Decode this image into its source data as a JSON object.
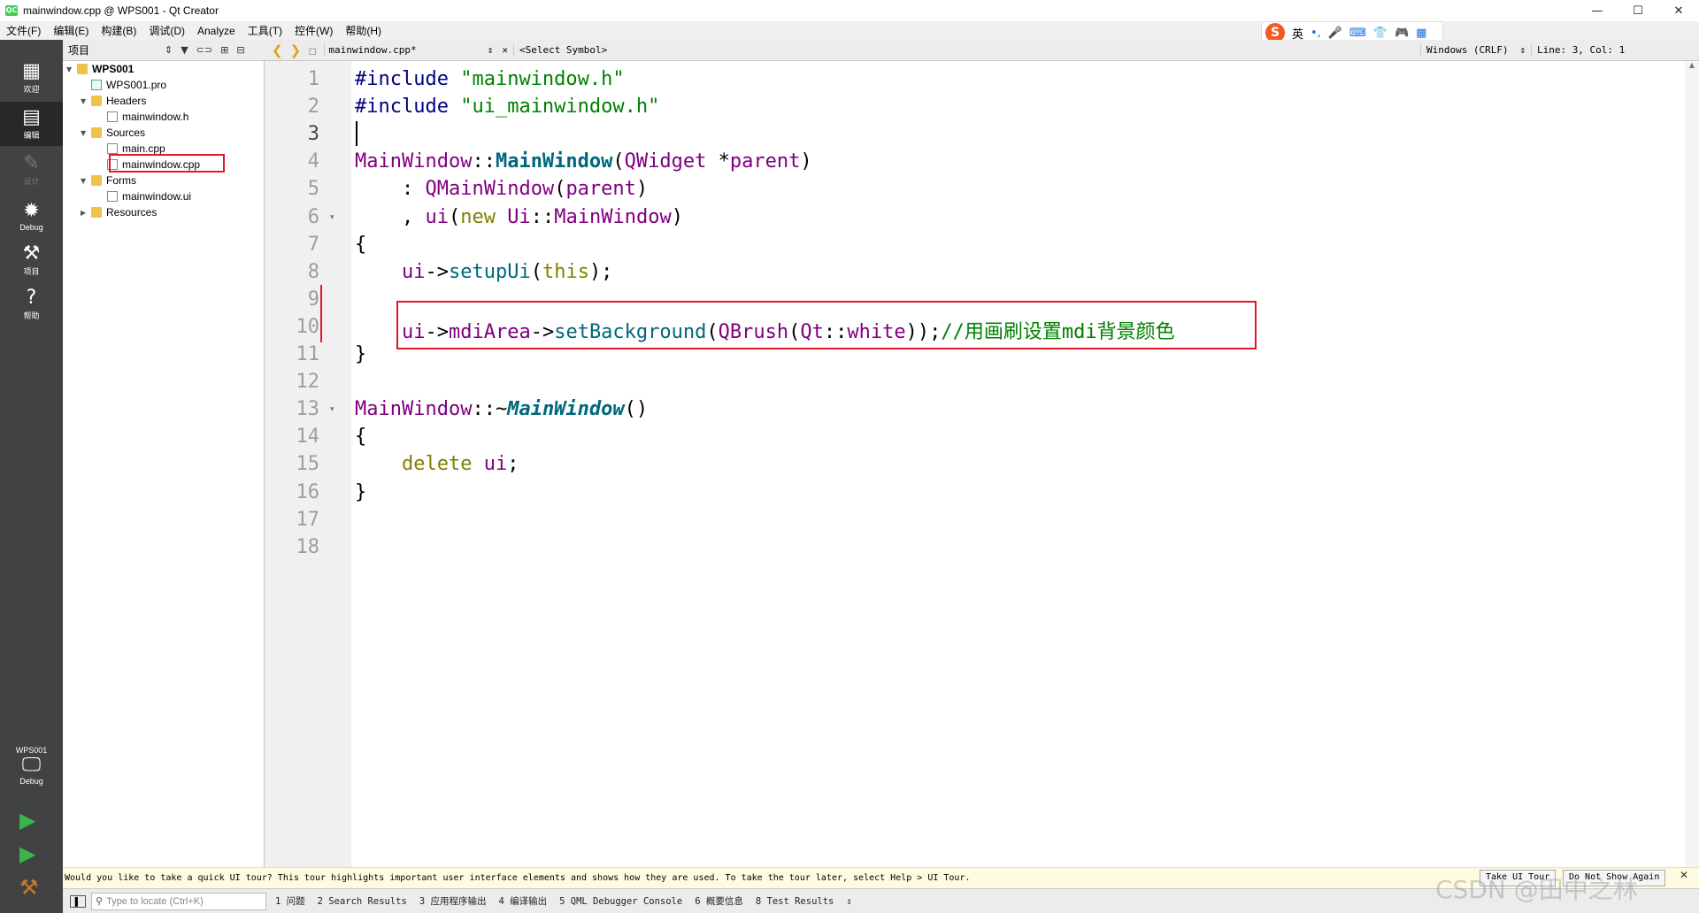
{
  "window": {
    "title": "mainwindow.cpp @ WPS001 - Qt Creator",
    "app_icon_text": "QC",
    "controls": [
      "—",
      "☐",
      "✕"
    ]
  },
  "menu": [
    "文件(F)",
    "编辑(E)",
    "构建(B)",
    "调试(D)",
    "Analyze",
    "工具(T)",
    "控件(W)",
    "帮助(H)"
  ],
  "ime": {
    "logo": "S",
    "lang": "英",
    "icons": [
      "•,",
      "🎤",
      "⌨",
      "👕",
      "🎮",
      "▦"
    ]
  },
  "modes": [
    {
      "label": "欢迎",
      "icon": "grid-icon"
    },
    {
      "label": "编辑",
      "icon": "edit-icon"
    },
    {
      "label": "设计",
      "icon": "pencil-icon"
    },
    {
      "label": "Debug",
      "icon": "bug-icon"
    },
    {
      "label": "项目",
      "icon": "wrench-icon"
    },
    {
      "label": "帮助",
      "icon": "help-icon"
    }
  ],
  "kit": {
    "project": "WPS001",
    "config": "Debug"
  },
  "project_pane": {
    "title": "项目",
    "tree": [
      {
        "label": "WPS001",
        "level": 0,
        "expanded": true,
        "kind": "project"
      },
      {
        "label": "WPS001.pro",
        "level": 1,
        "kind": "pro"
      },
      {
        "label": "Headers",
        "level": 1,
        "expanded": true,
        "kind": "folder"
      },
      {
        "label": "mainwindow.h",
        "level": 2,
        "kind": "file"
      },
      {
        "label": "Sources",
        "level": 1,
        "expanded": true,
        "kind": "folder"
      },
      {
        "label": "main.cpp",
        "level": 2,
        "kind": "file"
      },
      {
        "label": "mainwindow.cpp",
        "level": 2,
        "kind": "file",
        "selected": true
      },
      {
        "label": "Forms",
        "level": 1,
        "expanded": true,
        "kind": "folder"
      },
      {
        "label": "mainwindow.ui",
        "level": 2,
        "kind": "file"
      },
      {
        "label": "Resources",
        "level": 1,
        "expanded": false,
        "kind": "folder"
      }
    ]
  },
  "editor_toolbar": {
    "file": "mainwindow.cpp*",
    "symbol": "<Select Symbol>",
    "line_ending": "Windows (CRLF)",
    "position": "Line: 3, Col: 1"
  },
  "editor": {
    "current_line": 3,
    "line_numbers": [
      "1",
      "2",
      "3",
      "4",
      "5",
      "6",
      "7",
      "8",
      "9",
      "10",
      "11",
      "12",
      "13",
      "14",
      "15",
      "16",
      "17",
      "18"
    ],
    "fold_markers": [
      "▾",
      "▾"
    ],
    "lines": [
      [
        [
          "pp",
          "#include "
        ],
        [
          "str",
          "\"mainwindow.h\""
        ]
      ],
      [
        [
          "pp",
          "#include "
        ],
        [
          "str",
          "\"ui_mainwindow.h\""
        ]
      ],
      [],
      [
        [
          "ty",
          "MainWindow"
        ],
        [
          "op",
          "::"
        ],
        [
          "dec",
          "MainWindow"
        ],
        [
          "op",
          "("
        ],
        [
          "ty",
          "QWidget"
        ],
        [
          "op",
          " *"
        ],
        [
          "ty",
          "parent"
        ],
        [
          "op",
          ")"
        ]
      ],
      [
        [
          "op",
          "    : "
        ],
        [
          "ty",
          "QMainWindow"
        ],
        [
          "op",
          "("
        ],
        [
          "ty",
          "parent"
        ],
        [
          "op",
          ")"
        ]
      ],
      [
        [
          "op",
          "    , "
        ],
        [
          "ty",
          "ui"
        ],
        [
          "op",
          "("
        ],
        [
          "kw",
          "new"
        ],
        [
          "op",
          " "
        ],
        [
          "ty",
          "Ui"
        ],
        [
          "op",
          "::"
        ],
        [
          "ty",
          "MainWindow"
        ],
        [
          "op",
          ")"
        ]
      ],
      [
        [
          "op",
          "{"
        ]
      ],
      [
        [
          "op",
          "    "
        ],
        [
          "ty",
          "ui"
        ],
        [
          "op",
          "->"
        ],
        [
          "fn",
          "setupUi"
        ],
        [
          "op",
          "("
        ],
        [
          "kw",
          "this"
        ],
        [
          "op",
          ");"
        ]
      ],
      [],
      [
        [
          "op",
          "    "
        ],
        [
          "ty",
          "ui"
        ],
        [
          "op",
          "->"
        ],
        [
          "ty",
          "mdiArea"
        ],
        [
          "op",
          "->"
        ],
        [
          "fn",
          "setBackground"
        ],
        [
          "op",
          "("
        ],
        [
          "ty",
          "QBrush"
        ],
        [
          "op",
          "("
        ],
        [
          "ty",
          "Qt"
        ],
        [
          "op",
          "::"
        ],
        [
          "ty",
          "white"
        ],
        [
          "op",
          "));"
        ],
        [
          "cm",
          "//用画刷设置mdi背景颜色"
        ]
      ],
      [
        [
          "op",
          "}"
        ]
      ],
      [],
      [
        [
          "ty",
          "MainWindow"
        ],
        [
          "op",
          "::~"
        ],
        [
          "it",
          "MainWindow"
        ],
        [
          "op",
          "()"
        ]
      ],
      [
        [
          "op",
          "{"
        ]
      ],
      [
        [
          "op",
          "    "
        ],
        [
          "kw",
          "delete"
        ],
        [
          "op",
          " "
        ],
        [
          "ty",
          "ui"
        ],
        [
          "op",
          ";"
        ]
      ],
      [
        [
          "op",
          "}"
        ]
      ],
      [],
      []
    ]
  },
  "tour_bar": {
    "message": "Would you like to take a quick UI tour? This tour highlights important user interface elements and shows how they are used. To take the tour later, select Help > UI Tour.",
    "take_tour": "Take UI Tour",
    "dont_show": "Do Not Show Again",
    "close": "✕"
  },
  "status_bar": {
    "locate_placeholder": "Type to locate (Ctrl+K)",
    "tabs": [
      "1 问题",
      "2 Search Results",
      "3 应用程序输出",
      "4 编译输出",
      "5 QML Debugger Console",
      "6 概要信息",
      "8 Test Results"
    ],
    "more": "⇕"
  },
  "watermark": "CSDN @田中之林",
  "colors": {
    "highlight": "#e0182a",
    "mode_bar": "#404244",
    "run": "#39b54a"
  }
}
